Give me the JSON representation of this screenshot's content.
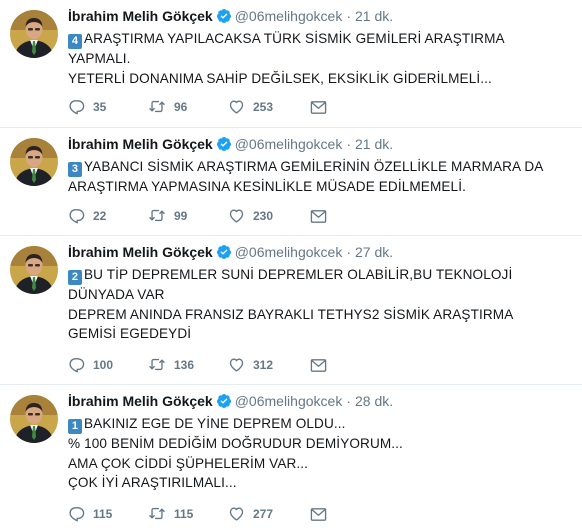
{
  "author": {
    "name": "İbrahim Melih Gökçek",
    "handle": "@06melihgokcek",
    "dot": "·"
  },
  "colors": {
    "verified": "#1da1f2",
    "badge": "#3b88c3",
    "secondary": "#657786"
  },
  "tweets": [
    {
      "time": "21 dk.",
      "badge": "4",
      "lines": [
        "ARAŞTIRMA YAPILACAKSA TÜRK SİSMİK GEMİLERİ ARAŞTIRMA",
        "YAPMALI.",
        "YETERLİ DONANIMA SAHİP DEĞİLSEK, EKSİKLİK GİDERİLMELİ..."
      ],
      "replies": "35",
      "retweets": "96",
      "likes": "253"
    },
    {
      "time": "21 dk.",
      "badge": "3",
      "lines": [
        "YABANCI SİSMİK ARAŞTIRMA GEMİLERİNİN ÖZELLİKLE MARMARA DA",
        "ARAŞTIRMA YAPMASINA KESİNLİKLE MÜSADE EDİLMEMELİ."
      ],
      "replies": "22",
      "retweets": "99",
      "likes": "230"
    },
    {
      "time": "27 dk.",
      "badge": "2",
      "lines": [
        "BU TİP DEPREMLER SUNİ DEPREMLER OLABİLİR,BU TEKNOLOJİ",
        "DÜNYADA VAR",
        "DEPREM ANINDA FRANSIZ BAYRAKLI TETHYS2 SİSMİK ARAŞTIRMA",
        "GEMİSİ EGEDEYDİ"
      ],
      "replies": "100",
      "retweets": "136",
      "likes": "312"
    },
    {
      "time": "28 dk.",
      "badge": "1",
      "lines": [
        "BAKINIZ EGE DE YİNE DEPREM OLDU...",
        "% 100 BENİM DEDİĞİM DOĞRUDUR DEMİYORUM...",
        "AMA ÇOK CİDDİ ŞÜPHELERİM VAR...",
        "ÇOK İYİ ARAŞTIRILMALI..."
      ],
      "replies": "115",
      "retweets": "115",
      "likes": "277"
    }
  ]
}
